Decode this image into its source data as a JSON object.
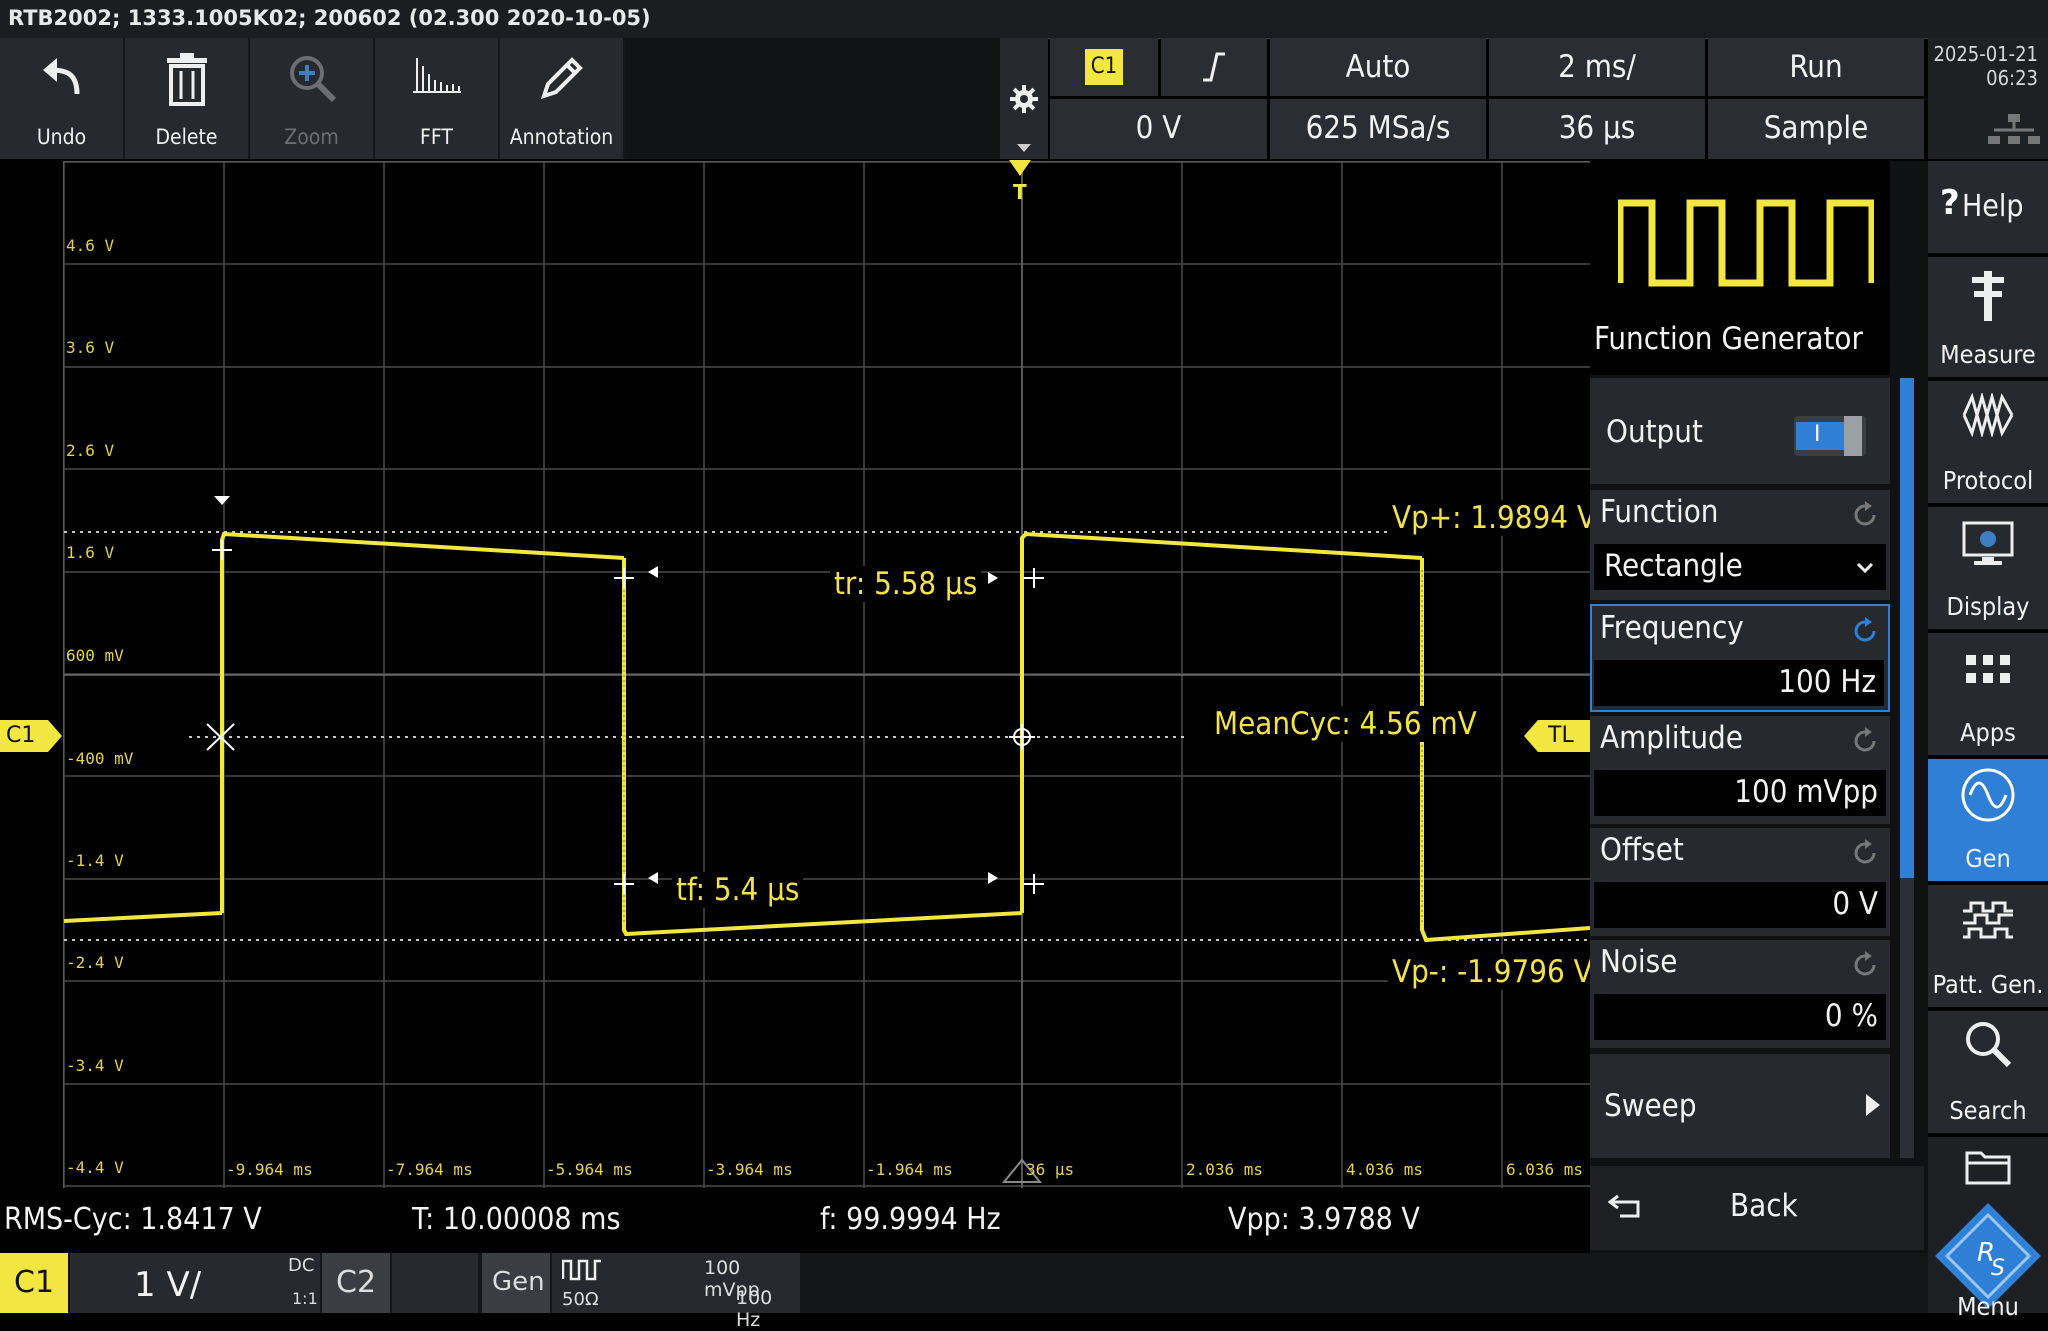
{
  "title": "RTB2002; 1333.1005K02; 200602 (02.300 2020-10-05)",
  "toolbar": {
    "undo": "Undo",
    "delete": "Delete",
    "zoom": "Zoom",
    "fft": "FFT",
    "annotation": "Annotation"
  },
  "status": {
    "channel": "C1",
    "trigger_level": "0 V",
    "trigger_mode": "Auto",
    "sample_rate": "625 MSa/s",
    "timebase": "2 ms/",
    "trigger_offset": "36 µs",
    "run_state": "Run",
    "acq_mode": "Sample",
    "date": "2025-01-21",
    "time": "06:23"
  },
  "plot": {
    "y_labels": [
      "4.6 V",
      "3.6 V",
      "2.6 V",
      "1.6 V",
      "600 mV",
      "-400 mV",
      "-1.4 V",
      "-2.4 V",
      "-3.4 V",
      "-4.4 V"
    ],
    "x_labels": [
      "-9.964 ms",
      "-7.964 ms",
      "-5.964 ms",
      "-3.964 ms",
      "-1.964 ms",
      "36 µs",
      "2.036 ms",
      "4.036 ms",
      "6.036 ms"
    ],
    "channel_marker": "C1",
    "trigger_marker": "T",
    "trigger_level_marker": "TL",
    "vp_plus": "Vp+: 1.9894 V",
    "vp_minus": "Vp-: -1.9796 V",
    "tr": "tr: 5.58 µs",
    "tf": "tf: 5.4 µs",
    "mean": "MeanCyc: 4.56 mV",
    "trace_color": "#f2e640"
  },
  "measurements": {
    "rms": "RMS-Cyc: 1.8417 V",
    "period": "T: 10.00008 ms",
    "freq": "f: 99.9994 Hz",
    "vpp": "Vpp: 3.9788 V"
  },
  "channels": {
    "c1": "C1",
    "c1_scale": "1 V/",
    "c1_coupling": "DC",
    "c1_ratio": "1:1",
    "c2": "C2",
    "gen": "Gen",
    "gen_imp": "50Ω",
    "gen_amp": "100 mVpp",
    "gen_freq": "100 Hz"
  },
  "panel": {
    "title": "Function Generator",
    "output_label": "Output",
    "output_on": "I",
    "function_label": "Function",
    "function_value": "Rectangle",
    "frequency_label": "Frequency",
    "frequency_value": "100 Hz",
    "amplitude_label": "Amplitude",
    "amplitude_value": "100 mVpp",
    "offset_label": "Offset",
    "offset_value": "0 V",
    "noise_label": "Noise",
    "noise_value": "0 %",
    "sweep_label": "Sweep",
    "back_label": "Back"
  },
  "side": {
    "help": "Help",
    "measure": "Measure",
    "protocol": "Protocol",
    "display": "Display",
    "apps": "Apps",
    "gen": "Gen",
    "patt": "Patt. Gen.",
    "search": "Search",
    "menu": "Menu"
  },
  "colors": {
    "accent": "#2f7fd6",
    "trace": "#f2e640",
    "toolbar": "#26292d"
  }
}
